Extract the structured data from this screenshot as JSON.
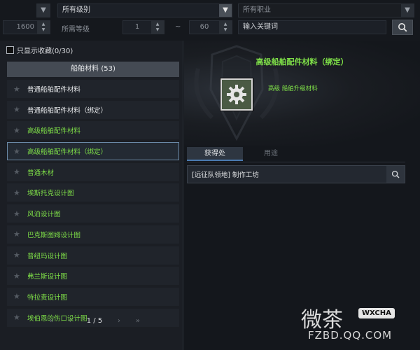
{
  "filters": {
    "row1": {
      "level_select": "所有级别",
      "class_select": "所有职业"
    },
    "row2": {
      "item_level_value": "1600",
      "required_level_label": "所需等级",
      "level_min": "1",
      "range_sep": "~",
      "level_max": "60",
      "search_placeholder": "输入关键词"
    }
  },
  "left": {
    "favorites_label": "只显示收藏(0/30)",
    "category_header": "船舶材料 (53)",
    "items": [
      {
        "label": "普通船舶配件材料",
        "grade": "white"
      },
      {
        "label": "普通船舶配件材料（绑定）",
        "grade": "white"
      },
      {
        "label": "高级船舶配件材料",
        "grade": "green"
      },
      {
        "label": "高级船舶配件材料（绑定）",
        "grade": "green",
        "selected": true
      },
      {
        "label": "普通木材",
        "grade": "green"
      },
      {
        "label": "埃斯托克设计图",
        "grade": "green"
      },
      {
        "label": "风泊设计图",
        "grade": "green"
      },
      {
        "label": "巴克斯图姆设计图",
        "grade": "green"
      },
      {
        "label": "普纽玛设计图",
        "grade": "green"
      },
      {
        "label": "弗兰斯设计图",
        "grade": "green"
      },
      {
        "label": "特拉责设计图",
        "grade": "green"
      },
      {
        "label": "埃伯恩的伤口设计图",
        "grade": "green"
      }
    ],
    "pager": {
      "first": "«",
      "prev": "‹",
      "page": "1 / 5",
      "next": "›",
      "last": "»"
    }
  },
  "detail": {
    "title": "高级船舶配件材料（绑定）",
    "subtitle": "高级 船舶升级材料",
    "tabs": [
      "获得处",
      "用途"
    ],
    "sources": [
      "[远征队领地] 制作工坊"
    ]
  },
  "watermark": {
    "big": "微茶",
    "badge": "WXCHA",
    "url": "FZBD.QQ.COM"
  },
  "colors": {
    "green_text": "#7fe048",
    "selected_border": "#6b8aa8",
    "accent_tab": "#4a7ab0"
  }
}
